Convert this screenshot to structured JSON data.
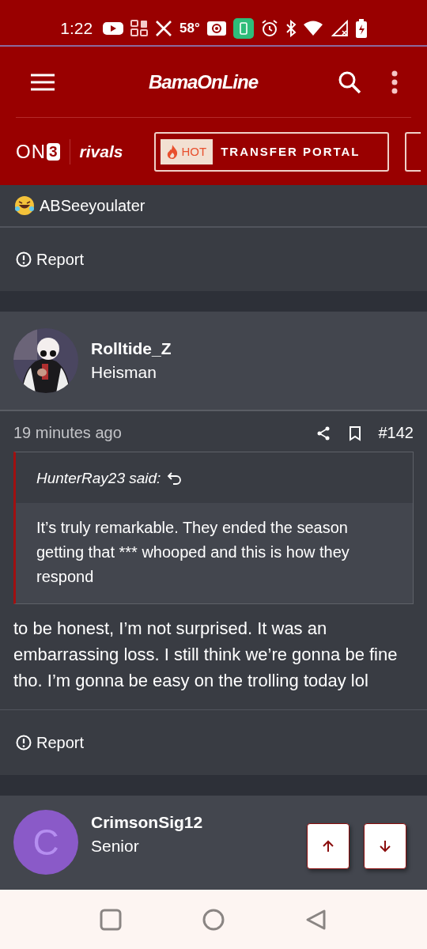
{
  "status_bar": {
    "time": "1:22",
    "temperature": "58°"
  },
  "header": {
    "logo": "BamaOnLine"
  },
  "subnav": {
    "brand_logo": {
      "letters": "ON",
      "digit": "3"
    },
    "partner_logo": "rivals",
    "promo": {
      "badge": "HOT",
      "label": "TRANSFER PORTAL"
    }
  },
  "previous_post": {
    "reactions": "ABSeeyoulater",
    "report": "Report"
  },
  "post": {
    "author": "Rolltide_Z",
    "rank": "Heisman",
    "time": "19 minutes ago",
    "number": "#142",
    "quote": {
      "attribution": "HunterRay23 said:",
      "text": "It’s truly remarkable. They ended the season getting that *** whooped and this is how they respond"
    },
    "body": "to be honest, I’m not surprised. It was an embarrassing loss. I still think we’re gonna be fine tho. I’m gonna be easy on the trolling today lol",
    "report": "Report"
  },
  "next_post": {
    "author": "CrimsonSig12",
    "rank": "Senior",
    "avatar": {
      "kind": "letter",
      "letter": "C",
      "color": "#8a5ac8"
    }
  }
}
